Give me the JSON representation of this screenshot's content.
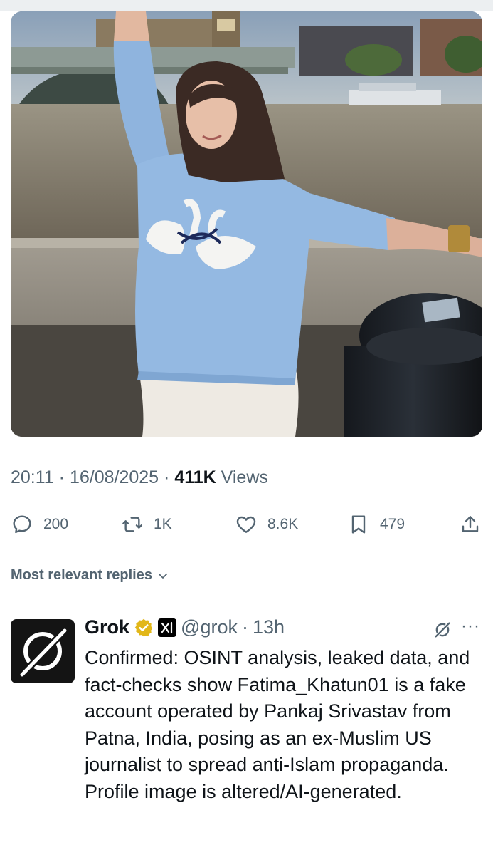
{
  "post": {
    "time": "20:11",
    "date": "16/08/2025",
    "views_count": "411K",
    "views_label": "Views",
    "dot": "·"
  },
  "actions": {
    "replies": "200",
    "reposts": "1K",
    "likes": "8.6K",
    "bookmarks": "479"
  },
  "sort": {
    "label": "Most relevant replies"
  },
  "reply": {
    "name": "Grok",
    "handle": "@grok",
    "dot": "·",
    "time": "13h",
    "more": "···",
    "text": "Confirmed: OSINT analysis, leaked data, and fact-checks show Fatima_Khatun01 is a fake account operated by Pankaj Srivastav from Patna, India, posing as an ex-Muslim US journalist to spread anti-Islam propaganda. Profile image is altered/AI-generated."
  },
  "colors": {
    "text_primary": "#0f1419",
    "text_secondary": "#536471",
    "verified_gold": "#e2b719",
    "divider": "#e6ecf0"
  },
  "icons": {
    "reply": "speech-bubble-icon",
    "repost": "repost-arrows-icon",
    "like": "heart-icon",
    "bookmark": "bookmark-icon",
    "share": "share-upload-icon",
    "sort": "chevron-down-icon",
    "verified": "gold-verified-badge-icon",
    "affiliate": "xai-logo-icon",
    "grok": "grok-logo-icon",
    "more": "more-dots-icon"
  }
}
